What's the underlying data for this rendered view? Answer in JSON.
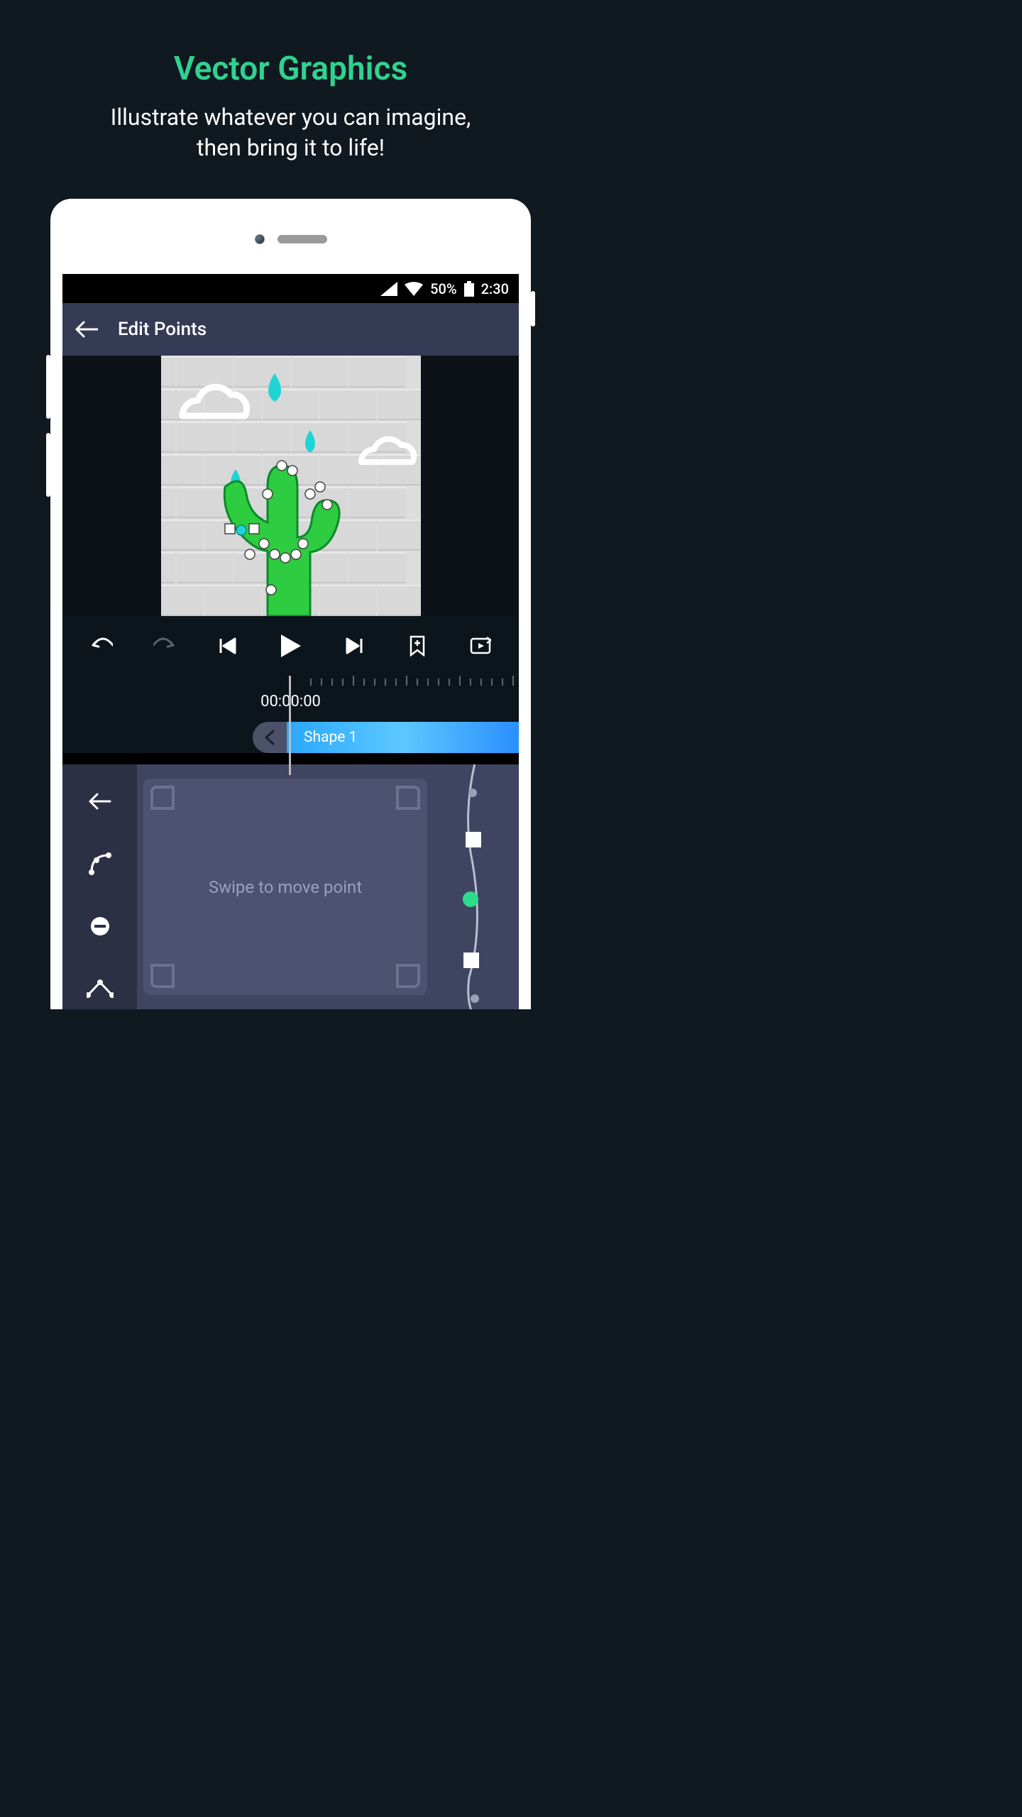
{
  "promo": {
    "title": "Vector Graphics",
    "subtitle_line1": "Illustrate whatever you can imagine,",
    "subtitle_line2": "then bring it to life!"
  },
  "status": {
    "battery_pct": "50%",
    "time": "2:30"
  },
  "header": {
    "title": "Edit Points"
  },
  "timeline": {
    "timecode": "00:00:00",
    "track_label": "Shape 1"
  },
  "panel": {
    "hint": "Swipe to move point"
  },
  "colors": {
    "accent": "#30d28f",
    "cactus": "#2ecc40",
    "raindrop": "#1fd4d4",
    "track_grad_a": "#2aa8ff",
    "track_grad_b": "#5dc8ff"
  }
}
